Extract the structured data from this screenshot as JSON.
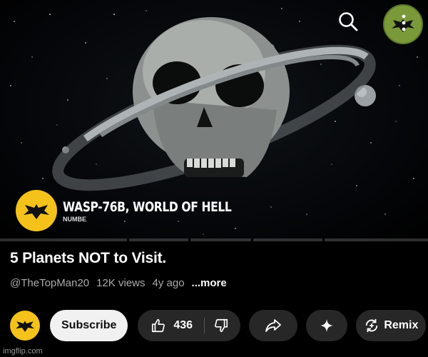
{
  "video": {
    "overlay_title": "WASP-76B, WORLD OF HELL",
    "overlay_subtitle": "NUMBE",
    "progress_fraction": 0.0
  },
  "header": {
    "search_icon": "search-icon",
    "avatar_icon": "bat-avatar-icon"
  },
  "info": {
    "title": "5 Planets NOT to Visit.",
    "channel_handle": "@TheTopMan20",
    "views": "12K views",
    "age": "4y ago",
    "more_label": "...more"
  },
  "actions": {
    "subscribe_label": "Subscribe",
    "like_count": "436",
    "remix_label": "Remix"
  },
  "watermark": "imgflip.com",
  "colors": {
    "background": "#000000",
    "pill": "#272727",
    "subscribe_bg": "#f1f1f1",
    "channel_avatar": "#f4c21a",
    "top_avatar": "#7a9a3a"
  }
}
